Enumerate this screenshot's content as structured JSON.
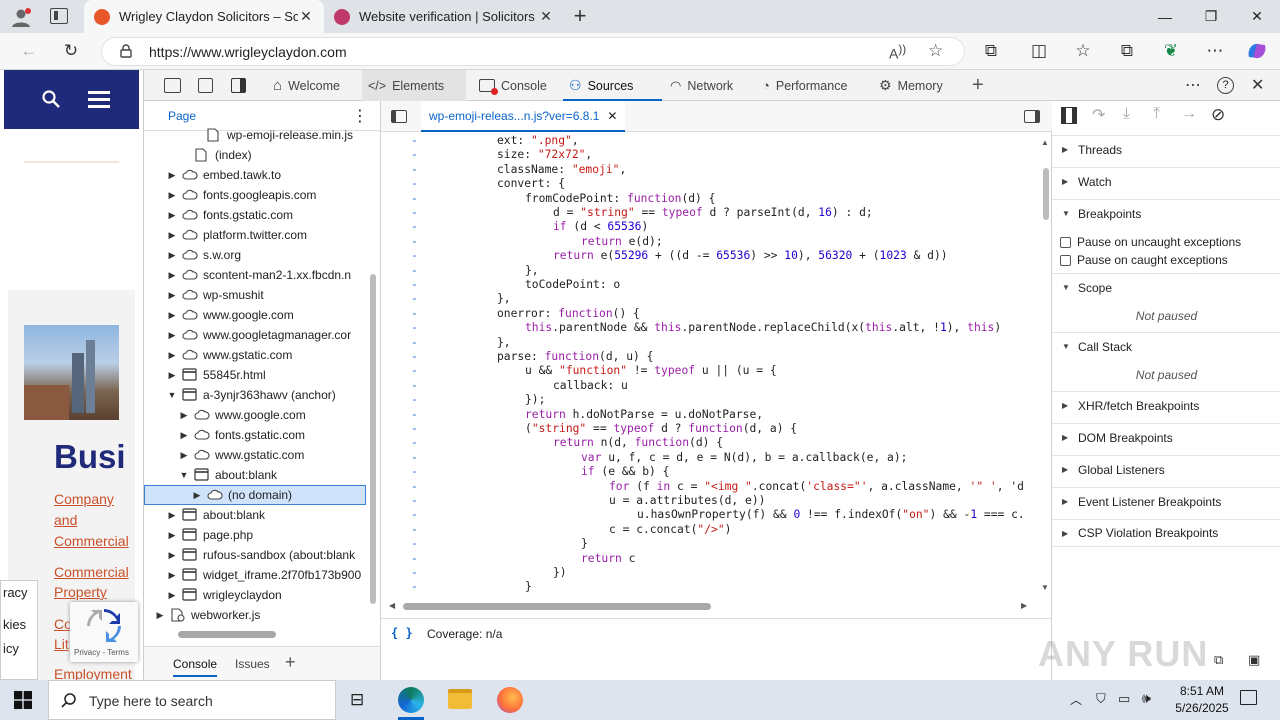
{
  "browser": {
    "tabs": [
      {
        "title": "Wrigley Claydon Solicitors – Solic",
        "favicon_color": "#e8562a",
        "active": true
      },
      {
        "title": "Website verification | Solicitors Re",
        "favicon_color": "#c0396b",
        "active": false
      }
    ],
    "new_tab_label": "+",
    "url": "https://www.wrigleyclaydon.com"
  },
  "site": {
    "heading_fragment": "Busi",
    "links": [
      "Company",
      "and",
      "Commercial",
      "Commercial",
      "Property",
      "Co",
      "Lit",
      "Employment"
    ],
    "cookie_fragments": [
      "racy",
      "kies",
      "icy"
    ],
    "recaptcha_label": "Privacy - Terms"
  },
  "devtools": {
    "tabs": [
      "Welcome",
      "Elements",
      "Console",
      "Sources",
      "Network",
      "Performance",
      "Memory"
    ],
    "active_tab": "Sources",
    "navigator_tab": "Page",
    "tree": [
      {
        "label": "wp-emoji-release.min.js",
        "depth": 3,
        "icon": "file"
      },
      {
        "label": "(index)",
        "depth": 2,
        "icon": "file"
      },
      {
        "label": "embed.tawk.to",
        "depth": 1,
        "icon": "cloud",
        "arrow": "right"
      },
      {
        "label": "fonts.googleapis.com",
        "depth": 1,
        "icon": "cloud",
        "arrow": "right"
      },
      {
        "label": "fonts.gstatic.com",
        "depth": 1,
        "icon": "cloud",
        "arrow": "right"
      },
      {
        "label": "platform.twitter.com",
        "depth": 1,
        "icon": "cloud",
        "arrow": "right"
      },
      {
        "label": "s.w.org",
        "depth": 1,
        "icon": "cloud",
        "arrow": "right"
      },
      {
        "label": "scontent-man2-1.xx.fbcdn.n",
        "depth": 1,
        "icon": "cloud",
        "arrow": "right"
      },
      {
        "label": "wp-smushit",
        "depth": 1,
        "icon": "cloud",
        "arrow": "right"
      },
      {
        "label": "www.google.com",
        "depth": 1,
        "icon": "cloud",
        "arrow": "right"
      },
      {
        "label": "www.googletagmanager.cor",
        "depth": 1,
        "icon": "cloud",
        "arrow": "right"
      },
      {
        "label": "www.gstatic.com",
        "depth": 1,
        "icon": "cloud",
        "arrow": "right"
      },
      {
        "label": "55845r.html",
        "depth": 1,
        "icon": "frame",
        "arrow": "right"
      },
      {
        "label": "a-3ynjr363hawv (anchor)",
        "depth": 1,
        "icon": "frame",
        "arrow": "down"
      },
      {
        "label": "www.google.com",
        "depth": 2,
        "icon": "cloud",
        "arrow": "right"
      },
      {
        "label": "fonts.gstatic.com",
        "depth": 2,
        "icon": "cloud",
        "arrow": "right"
      },
      {
        "label": "www.gstatic.com",
        "depth": 2,
        "icon": "cloud",
        "arrow": "right"
      },
      {
        "label": "about:blank",
        "depth": 2,
        "icon": "frame",
        "arrow": "down"
      },
      {
        "label": "(no domain)",
        "depth": 3,
        "icon": "cloud",
        "arrow": "right",
        "selected": true
      },
      {
        "label": "about:blank",
        "depth": 1,
        "icon": "frame",
        "arrow": "right"
      },
      {
        "label": "page.php",
        "depth": 1,
        "icon": "frame",
        "arrow": "right"
      },
      {
        "label": "rufous-sandbox (about:blank",
        "depth": 1,
        "icon": "frame",
        "arrow": "right"
      },
      {
        "label": "widget_iframe.2f70fb173b900",
        "depth": 1,
        "icon": "frame",
        "arrow": "right"
      },
      {
        "label": "wrigleyclaydon",
        "depth": 1,
        "icon": "frame",
        "arrow": "right"
      },
      {
        "label": "webworker.js",
        "depth": 0,
        "icon": "gear",
        "arrow": "right"
      }
    ],
    "editor_tab": "wp-emoji-releas...n.js?ver=6.8.1",
    "code_lines": [
      {
        "i": 0,
        "t": "ext: \".png\","
      },
      {
        "i": 0,
        "t": "size: \"72x72\","
      },
      {
        "i": 0,
        "t": "className: \"emoji\","
      },
      {
        "i": 0,
        "t": "convert: {"
      },
      {
        "i": 1,
        "t": "fromCodePoint: function(d) {"
      },
      {
        "i": 2,
        "t": "d = \"string\" == typeof d ? parseInt(d, 16) : d;"
      },
      {
        "i": 2,
        "t": "if (d < 65536)"
      },
      {
        "i": 3,
        "t": "return e(d);"
      },
      {
        "i": 2,
        "t": "return e(55296 + ((d -= 65536) >> 10), 56320 + (1023 & d))"
      },
      {
        "i": 1,
        "t": "},"
      },
      {
        "i": 1,
        "t": "toCodePoint: o"
      },
      {
        "i": 0,
        "t": "},"
      },
      {
        "i": 0,
        "t": "onerror: function() {"
      },
      {
        "i": 1,
        "t": "this.parentNode && this.parentNode.replaceChild(x(this.alt, !1), this)"
      },
      {
        "i": 0,
        "t": "},"
      },
      {
        "i": 0,
        "t": "parse: function(d, u) {"
      },
      {
        "i": 1,
        "t": "u && \"function\" != typeof u || (u = {"
      },
      {
        "i": 2,
        "t": "callback: u"
      },
      {
        "i": 1,
        "t": "});"
      },
      {
        "i": 1,
        "t": "return h.doNotParse = u.doNotParse,"
      },
      {
        "i": 1,
        "t": "(\"string\" == typeof d ? function(d, a) {"
      },
      {
        "i": 2,
        "t": "return n(d, function(d) {"
      },
      {
        "i": 3,
        "t": "var u, f, c = d, e = N(d), b = a.callback(e, a);"
      },
      {
        "i": 3,
        "t": "if (e && b) {"
      },
      {
        "i": 4,
        "t": "for (f in c = \"<img \".concat('class=\"', a.className, '\" ', 'd"
      },
      {
        "i": 4,
        "t": "u = a.attributes(d, e))"
      },
      {
        "i": 5,
        "t": "u.hasOwnProperty(f) && 0 !== f.indexOf(\"on\") && -1 === c."
      },
      {
        "i": 4,
        "t": "c = c.concat(\"/>\")"
      },
      {
        "i": 3,
        "t": "}"
      },
      {
        "i": 3,
        "t": "return c"
      },
      {
        "i": 2,
        "t": "})"
      },
      {
        "i": 1,
        "t": "}"
      }
    ],
    "coverage": "Coverage: n/a",
    "debugger": {
      "threads": "Threads",
      "watch": "Watch",
      "breakpoints": "Breakpoints",
      "pause_uncaught": "Pause on uncaught exceptions",
      "pause_caught": "Pause on caught exceptions",
      "scope": "Scope",
      "not_paused": "Not paused",
      "call_stack": "Call Stack",
      "xhr": "XHR/fetch Breakpoints",
      "dom": "DOM Breakpoints",
      "global": "Global Listeners",
      "event": "Event Listener Breakpoints",
      "csp": "CSP Violation Breakpoints"
    },
    "drawer_tabs": [
      "Console",
      "Issues"
    ]
  },
  "watermark": "ANY RUN",
  "taskbar": {
    "search_placeholder": "Type here to search",
    "time": "8:51 AM",
    "date": "5/26/2025"
  },
  "colors": {
    "accent": "#0a64c8",
    "site_navy": "#1f2a7a",
    "link_orange": "#c9502a"
  }
}
